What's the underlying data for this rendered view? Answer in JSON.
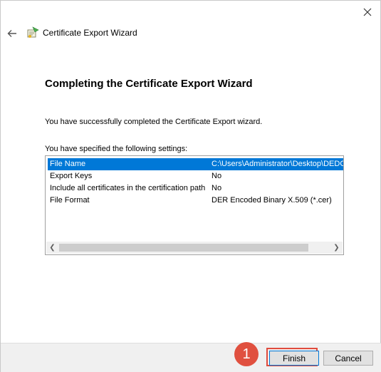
{
  "window": {
    "title": "Certificate Export Wizard",
    "heading": "Completing the Certificate Export Wizard",
    "message": "You have successfully completed the Certificate Export wizard.",
    "settings_label": "You have specified the following settings:"
  },
  "settings": [
    {
      "name": "File Name",
      "value": "C:\\Users\\Administrator\\Desktop\\DEDC",
      "selected": true
    },
    {
      "name": "Export Keys",
      "value": "No",
      "selected": false
    },
    {
      "name": "Include all certificates in the certification path",
      "value": "No",
      "selected": false
    },
    {
      "name": "File Format",
      "value": "DER Encoded Binary X.509 (*.cer)",
      "selected": false
    }
  ],
  "buttons": {
    "finish": "Finish",
    "cancel": "Cancel"
  },
  "annotation": {
    "step_number": "1"
  },
  "icons": {
    "close": "close-icon",
    "back": "back-arrow-icon",
    "wizard": "certificate-wizard-icon",
    "scroll_left": "scroll-left-icon",
    "scroll_right": "scroll-right-icon"
  },
  "colors": {
    "selection": "#0078d7",
    "annotation": "#e04b3e"
  }
}
